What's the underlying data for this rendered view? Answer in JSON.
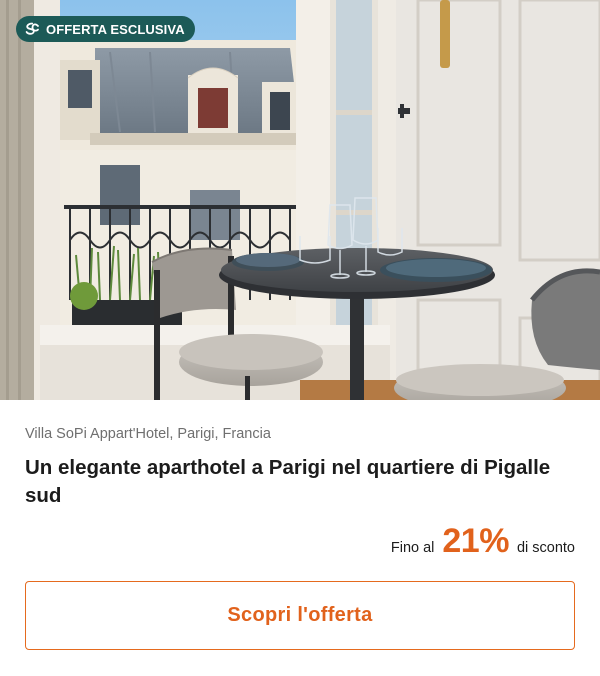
{
  "offer": {
    "badge_label": "OFFERTA ESCLUSIVA",
    "location": "Villa SoPi Appart'Hotel, Parigi, Francia",
    "title": "Un elegante aparthotel a Parigi nel quartiere di Pigalle sud",
    "discount": {
      "prefix": "Fino al",
      "value": "21%",
      "suffix": "di sconto"
    },
    "cta_label": "Scopri l'offerta"
  },
  "icons": {
    "badge": "brand-logo-icon"
  },
  "colors": {
    "accent": "#e1621c",
    "badge_background": "#1c5a57",
    "text_primary": "#1c1c1c",
    "text_secondary": "#6f6f6f"
  }
}
